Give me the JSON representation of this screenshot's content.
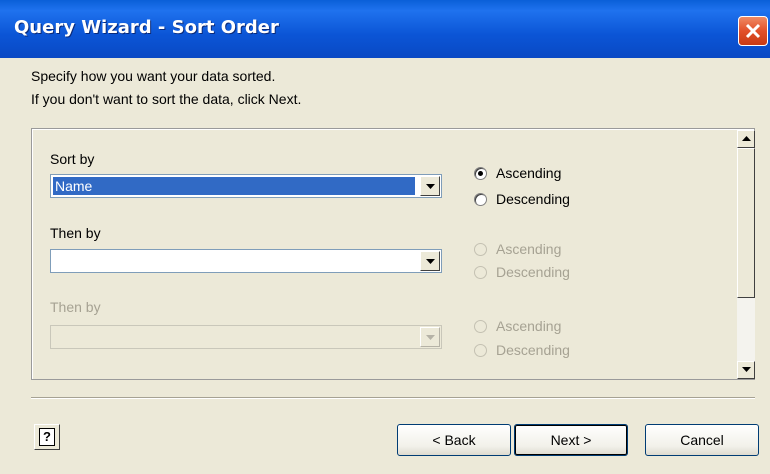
{
  "window": {
    "title": "Query Wizard - Sort Order"
  },
  "instructions": {
    "line1": "Specify how you want your data sorted.",
    "line2": "If you don't want to sort the data, click Next."
  },
  "sort_by": {
    "label": "Sort by",
    "value": "Name",
    "ascending_label": "Ascending",
    "descending_label": "Descending",
    "selected": "Ascending"
  },
  "then_by_1": {
    "label": "Then by",
    "value": "",
    "ascending_label": "Ascending",
    "descending_label": "Descending"
  },
  "then_by_2": {
    "label": "Then by",
    "value": "",
    "ascending_label": "Ascending",
    "descending_label": "Descending"
  },
  "buttons": {
    "help": "?",
    "back": "< Back",
    "next": "Next >",
    "cancel": "Cancel"
  },
  "icons": {
    "close": "close-x-icon",
    "dropdown": "triangle-down-icon",
    "scroll_up": "triangle-up-icon",
    "scroll_down": "triangle-down-icon",
    "help": "help-icon"
  }
}
